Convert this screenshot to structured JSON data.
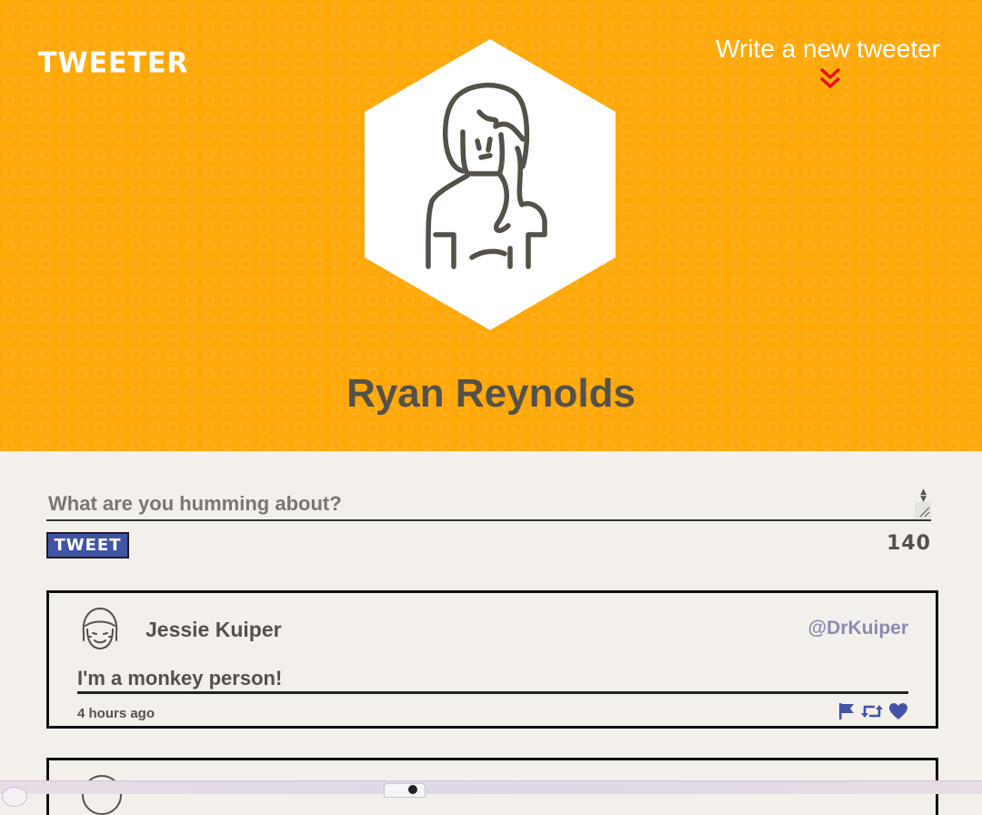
{
  "nav": {
    "brand": "TWEETER",
    "compose_label": "Write a new tweeter"
  },
  "profile": {
    "name": "Ryan Reynolds"
  },
  "composer": {
    "placeholder": "What are you humming about?",
    "button_label": "TWEET",
    "char_counter": "140"
  },
  "tweets": [
    {
      "author": "Jessie Kuiper",
      "handle": "@DrKuiper",
      "content": "I'm a monkey person!",
      "time": "4 hours ago"
    }
  ],
  "colors": {
    "header_bg": "#ffa80a",
    "page_bg": "#f3f0ec",
    "text": "#545149",
    "accent_button": "#4254a6",
    "handle": "#8a8ab5",
    "chevron": "#e8110a"
  },
  "icons": {
    "compose": "double-chevron-down-icon",
    "flag": "flag-icon",
    "retweet": "retweet-icon",
    "like": "heart-icon"
  }
}
